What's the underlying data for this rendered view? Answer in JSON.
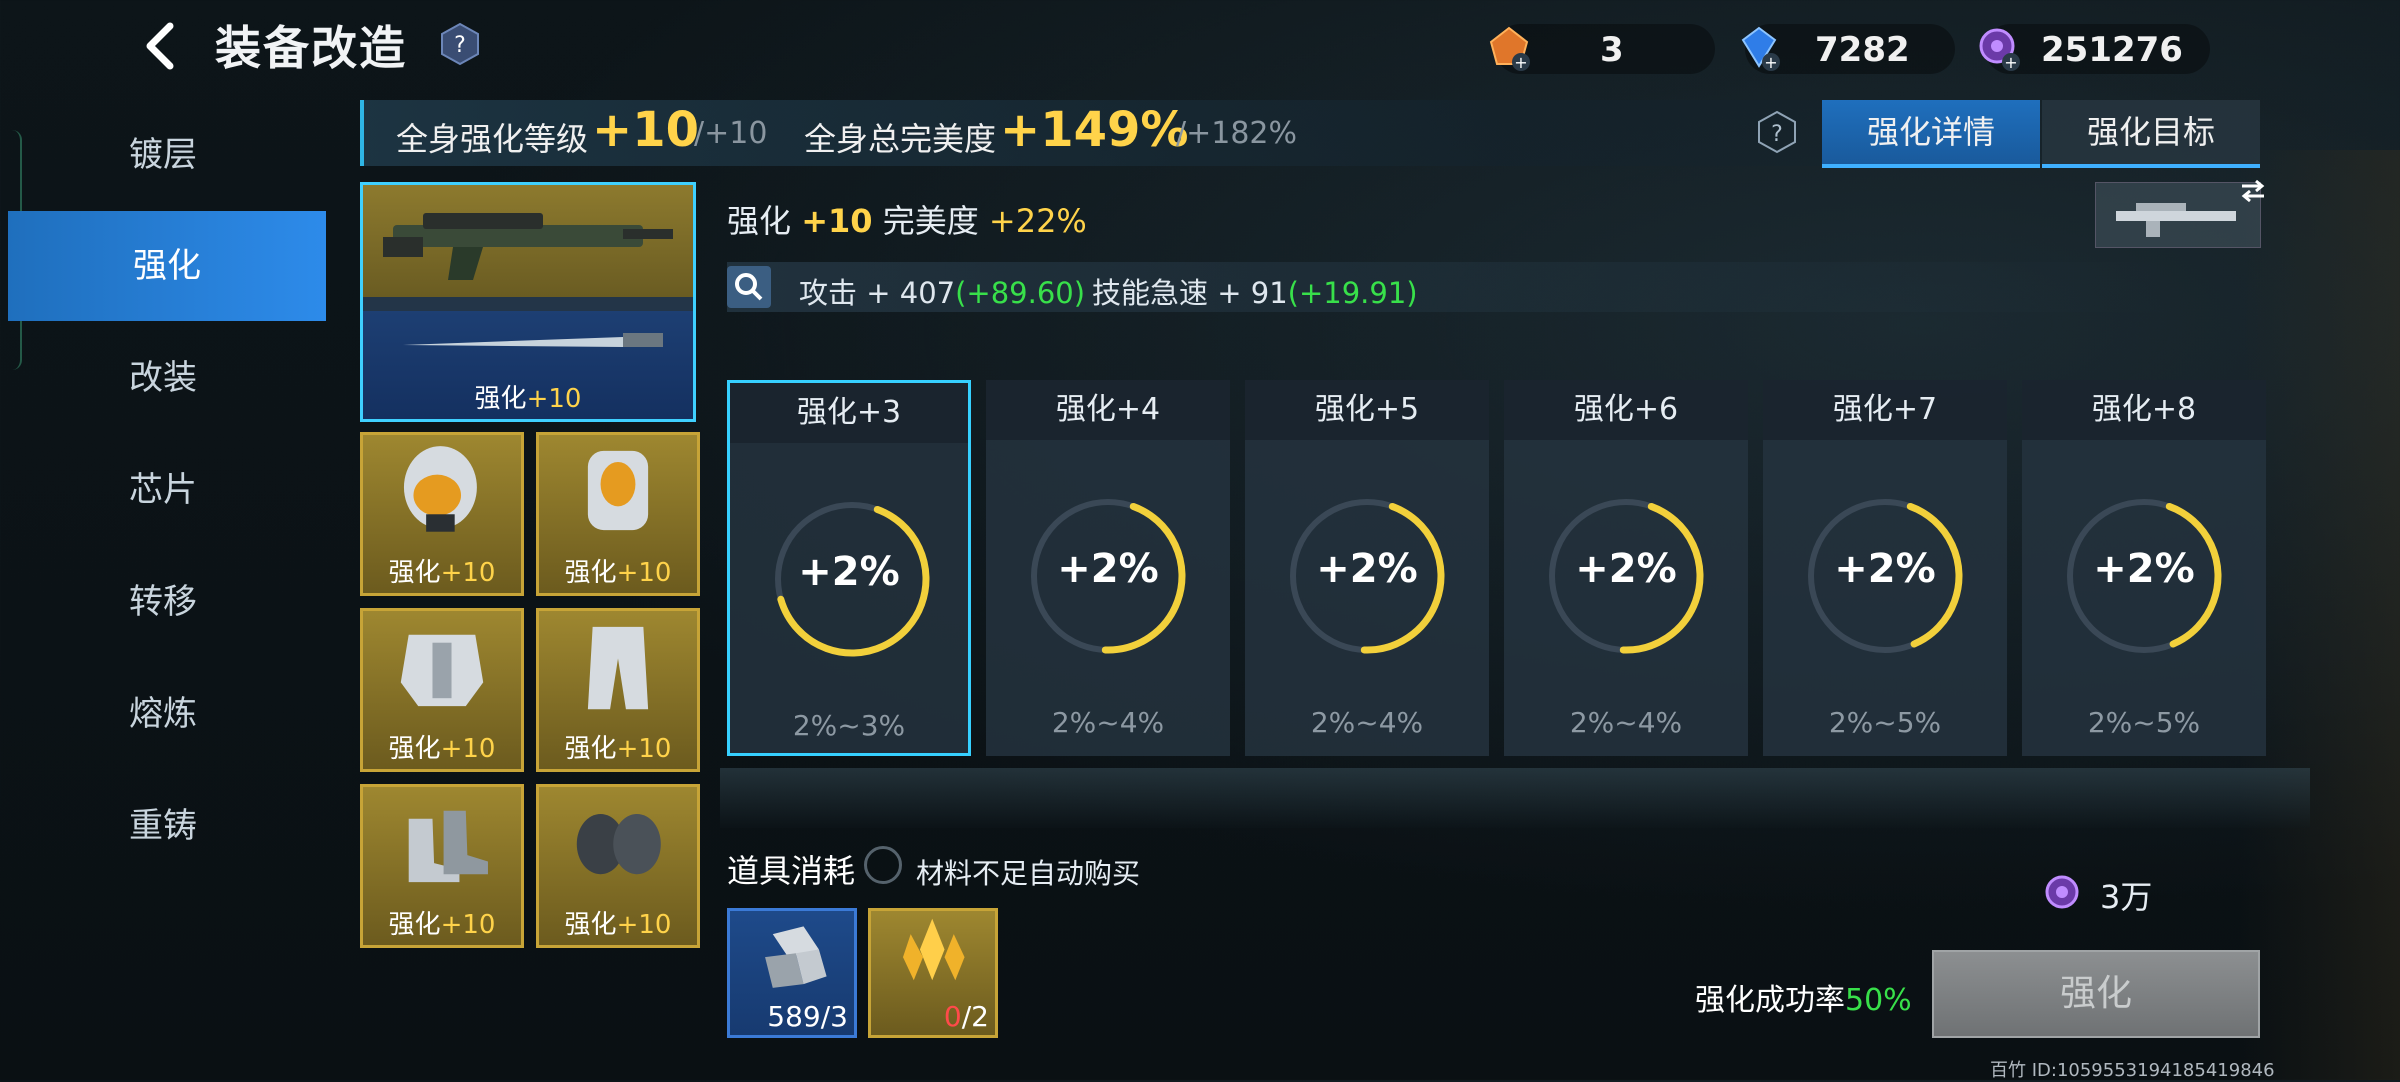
{
  "header": {
    "title": "装备改造",
    "currencies": [
      {
        "icon": "orange-gem-icon",
        "value": "3"
      },
      {
        "icon": "blue-diamond-icon",
        "value": "7282"
      },
      {
        "icon": "purple-coin-icon",
        "value": "251276"
      }
    ]
  },
  "sidebar": {
    "items": [
      {
        "label": "镀层"
      },
      {
        "label": "强化"
      },
      {
        "label": "改装"
      },
      {
        "label": "芯片"
      },
      {
        "label": "转移"
      },
      {
        "label": "熔炼"
      },
      {
        "label": "重铸"
      }
    ],
    "active_index": 1
  },
  "statbar": {
    "level_label": "全身强化等级",
    "level_value": "+10",
    "level_max": "/+10",
    "perfect_label": "全身总完美度",
    "perfect_value": "+149%",
    "perfect_max": "/+182%"
  },
  "tabs": [
    {
      "label": "强化详情",
      "active": true
    },
    {
      "label": "强化目标",
      "active": false
    }
  ],
  "equipment": {
    "weapon_label_prefix": "强化",
    "weapon_label_plus": "+10",
    "items": [
      {
        "prefix": "强化",
        "plus": "+10"
      },
      {
        "prefix": "强化",
        "plus": "+10"
      },
      {
        "prefix": "强化",
        "plus": "+10"
      },
      {
        "prefix": "强化",
        "plus": "+10"
      },
      {
        "prefix": "强化",
        "plus": "+10"
      },
      {
        "prefix": "强化",
        "plus": "+10"
      }
    ]
  },
  "detail": {
    "enh_prefix": "强化",
    "enh_level": "+10",
    "perfect_label": "完美度",
    "perfect_value": "+22%",
    "attack_label": "攻击",
    "attack_value": "+ 407",
    "attack_bonus": "(+89.60)",
    "haste_label": "技能急速",
    "haste_value": "+ 91",
    "haste_bonus": "(+19.91)"
  },
  "levels": [
    {
      "label": "强化+3",
      "pct": "+2%",
      "range": "2%~3%",
      "fill": 0.65
    },
    {
      "label": "强化+4",
      "pct": "+2%",
      "range": "2%~4%",
      "fill": 0.45
    },
    {
      "label": "强化+5",
      "pct": "+2%",
      "range": "2%~4%",
      "fill": 0.45
    },
    {
      "label": "强化+6",
      "pct": "+2%",
      "range": "2%~4%",
      "fill": 0.45
    },
    {
      "label": "强化+7",
      "pct": "+2%",
      "range": "2%~5%",
      "fill": 0.38
    },
    {
      "label": "强化+8",
      "pct": "+2%",
      "range": "2%~5%",
      "fill": 0.38
    }
  ],
  "consume": {
    "label": "道具消耗",
    "auto_buy_label": "材料不足自动购买",
    "items": [
      {
        "have": "589",
        "need": "/3"
      },
      {
        "have": "0",
        "need": "/2"
      }
    ],
    "cost": "3万"
  },
  "action": {
    "rate_label": "强化成功率",
    "rate_value": "50%",
    "button_label": "强化"
  },
  "footer": {
    "uid": "百竹 ID:1059553194185419846"
  },
  "colors": {
    "accent_blue": "#2d8bea",
    "gold": "#ffd34a",
    "green": "#38e04a",
    "ring": "#f2d03b"
  }
}
